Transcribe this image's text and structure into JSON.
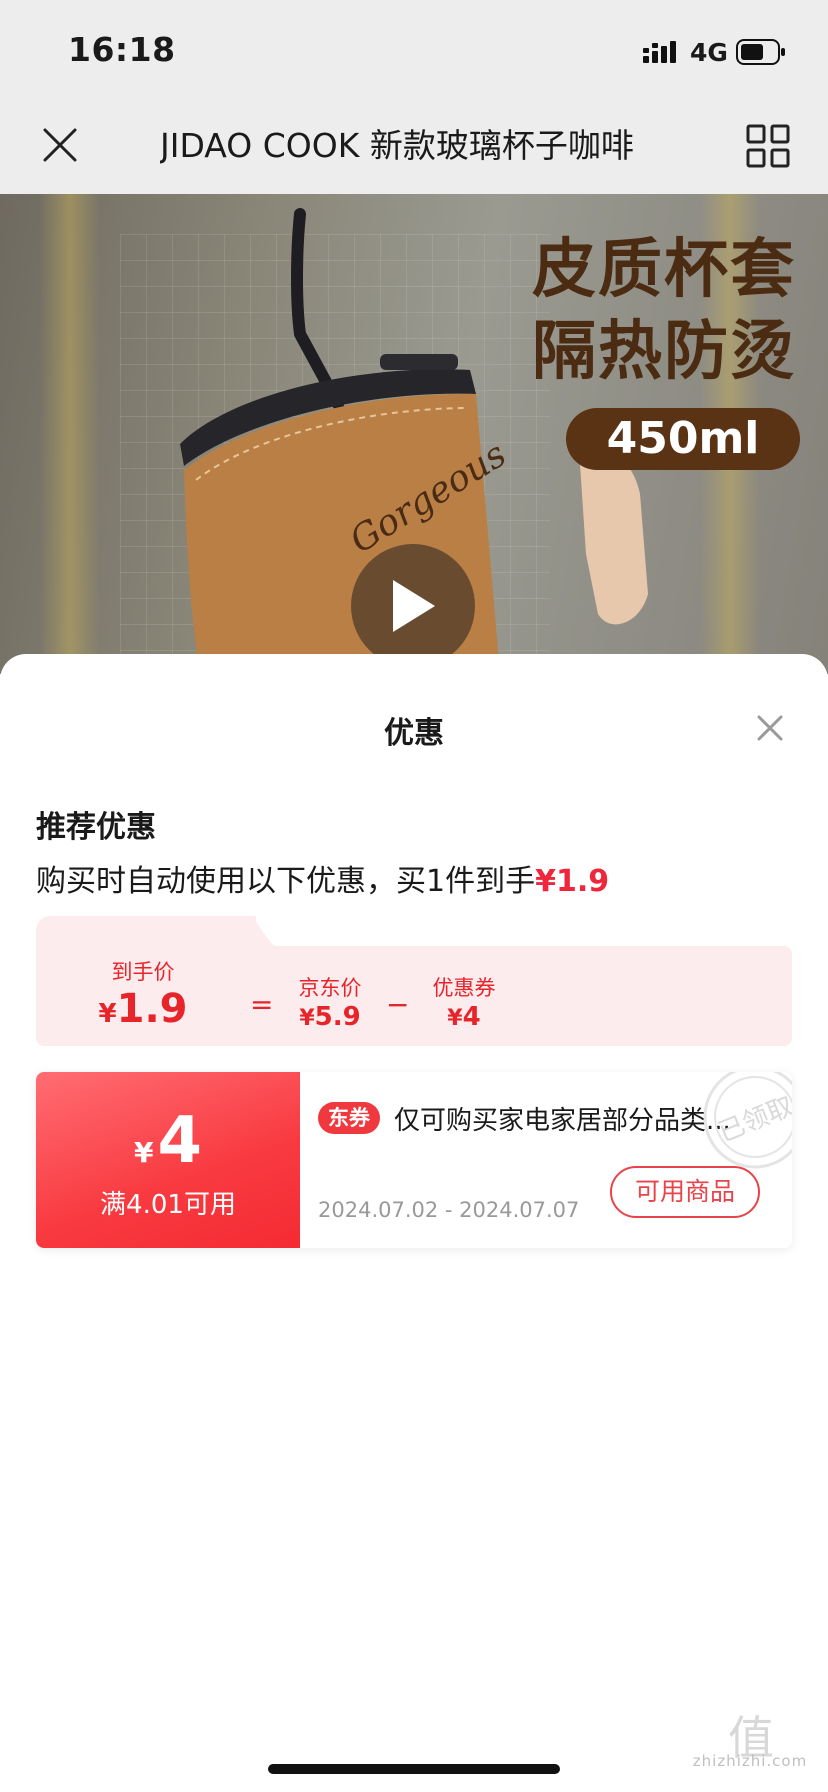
{
  "status_bar": {
    "time": "16:18",
    "network": "4G"
  },
  "nav": {
    "title": "JIDAO COOK 新款玻璃杯子咖啡"
  },
  "hero": {
    "headline_line1": "皮质杯套",
    "headline_line2": "隔热防烫",
    "volume": "450ml",
    "sleeve_logo": "Gorgeous"
  },
  "sheet": {
    "title": "优惠",
    "section_title": "推荐优惠",
    "summary_prefix": "购买时自动使用以下优惠，买1件到手",
    "summary_price": "¥1.9",
    "breakdown": {
      "final_label": "到手价",
      "final_currency": "¥",
      "final_value": "1.9",
      "equals": "=",
      "jd_label": "京东价",
      "jd_currency": "¥",
      "jd_value": "5.9",
      "minus": "−",
      "coupon_label": "优惠券",
      "coupon_currency": "¥",
      "coupon_value": "4"
    },
    "coupon": {
      "currency": "¥",
      "amount": "4",
      "condition": "满4.01可用",
      "tag": "东券",
      "description": "仅可购买家电家居部分品类...",
      "date_range": "2024.07.02 - 2024.07.07",
      "action_label": "可用商品",
      "stamp_text": "已领取"
    }
  },
  "watermark": {
    "brand": "值",
    "domain": "zhizhizhi.com"
  },
  "colors": {
    "accent_red": "#f0263a",
    "breakdown_bg": "#fdeced",
    "coupon_red": "#f83a40",
    "hero_brown": "#5a3214"
  }
}
